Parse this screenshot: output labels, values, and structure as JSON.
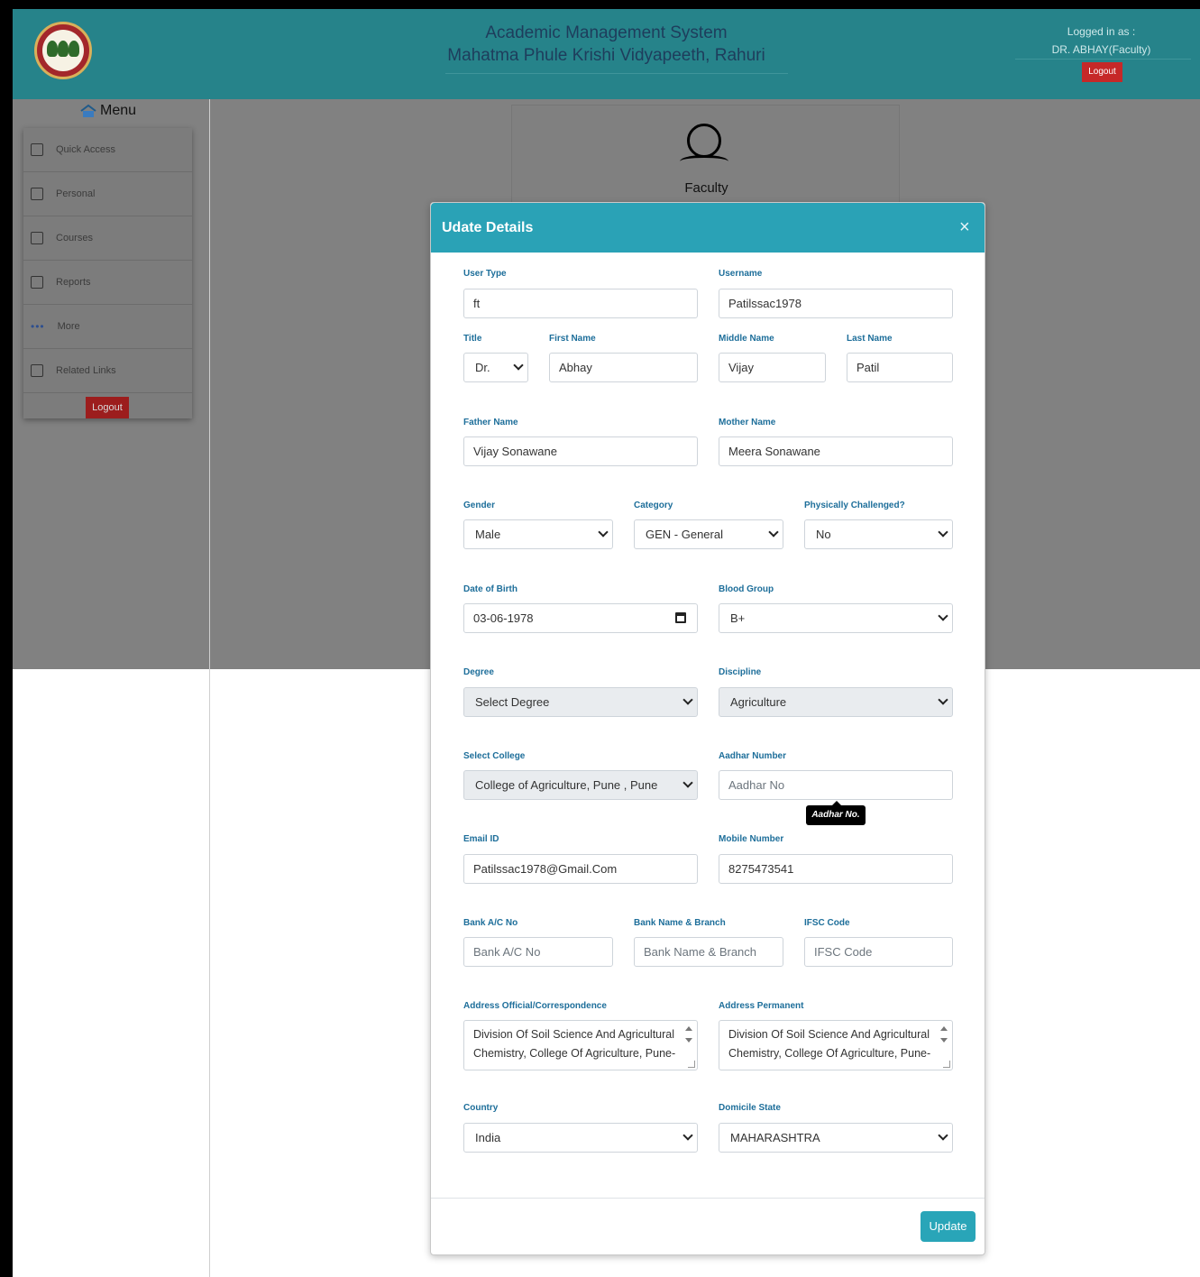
{
  "header": {
    "title_line1": "Academic Management System",
    "title_line2": "Mahatma Phule Krishi Vidyapeeth, Rahuri",
    "logged_in_label": "Logged in as :",
    "logged_in_user": "DR. ABHAY(Faculty)",
    "logout_label": "Logout"
  },
  "sidebar": {
    "title": "Menu",
    "items": [
      {
        "label": "Quick Access",
        "icon": "quick-access-icon"
      },
      {
        "label": "Personal",
        "icon": "personal-icon"
      },
      {
        "label": "Courses",
        "icon": "courses-icon"
      },
      {
        "label": "Reports",
        "icon": "reports-icon"
      },
      {
        "label": "More",
        "icon": "more-icon"
      },
      {
        "label": "Related Links",
        "icon": "related-links-icon"
      }
    ],
    "logout_label": "Logout"
  },
  "faculty_card": {
    "label": "Faculty",
    "icon": "user-icon"
  },
  "modal": {
    "title": "Udate Details",
    "close": "×",
    "update_label": "Update",
    "tooltip": "Aadhar No.",
    "fields": {
      "user_type": {
        "label": "User Type",
        "value": "ft"
      },
      "username": {
        "label": "Username",
        "value": "Patilssac1978"
      },
      "title": {
        "label": "Title",
        "value": "Dr."
      },
      "first_name": {
        "label": "First Name",
        "value": "Abhay"
      },
      "middle_name": {
        "label": "Middle Name",
        "value": "Vijay"
      },
      "last_name": {
        "label": "Last Name",
        "value": "Patil"
      },
      "father_name": {
        "label": "Father Name",
        "value": "Vijay Sonawane"
      },
      "mother_name": {
        "label": "Mother Name",
        "value": "Meera Sonawane"
      },
      "gender": {
        "label": "Gender",
        "value": "Male"
      },
      "category": {
        "label": "Category",
        "value": "GEN - General"
      },
      "physically_challenged": {
        "label": "Physically Challenged?",
        "value": "No"
      },
      "dob": {
        "label": "Date of Birth",
        "value": "03-06-1978"
      },
      "blood_group": {
        "label": "Blood Group",
        "value": "B+"
      },
      "degree": {
        "label": "Degree",
        "value": "Select Degree"
      },
      "discipline": {
        "label": "Discipline",
        "value": "Agriculture"
      },
      "college": {
        "label": "Select College",
        "value": "College of Agriculture, Pune , Pune"
      },
      "aadhar": {
        "label": "Aadhar Number",
        "placeholder": "Aadhar No"
      },
      "email": {
        "label": "Email ID",
        "value": "Patilssac1978@Gmail.Com"
      },
      "mobile": {
        "label": "Mobile Number",
        "value": "8275473541"
      },
      "bank_ac": {
        "label": "Bank A/C No",
        "placeholder": "Bank A/C No"
      },
      "bank_name": {
        "label": "Bank Name & Branch",
        "placeholder": "Bank Name & Branch"
      },
      "ifsc": {
        "label": "IFSC Code",
        "placeholder": "IFSC Code"
      },
      "address_official": {
        "label": "Address Official/Correspondence",
        "value": "Division Of Soil Science And Agricultural Chemistry, College Of Agriculture, Pune-"
      },
      "address_permanent": {
        "label": "Address Permanent",
        "value": "Division Of Soil Science And Agricultural Chemistry, College Of Agriculture, Pune-"
      },
      "country": {
        "label": "Country",
        "value": "India"
      },
      "domicile_state": {
        "label": "Domicile State",
        "value": "MAHARASHTRA"
      }
    }
  }
}
